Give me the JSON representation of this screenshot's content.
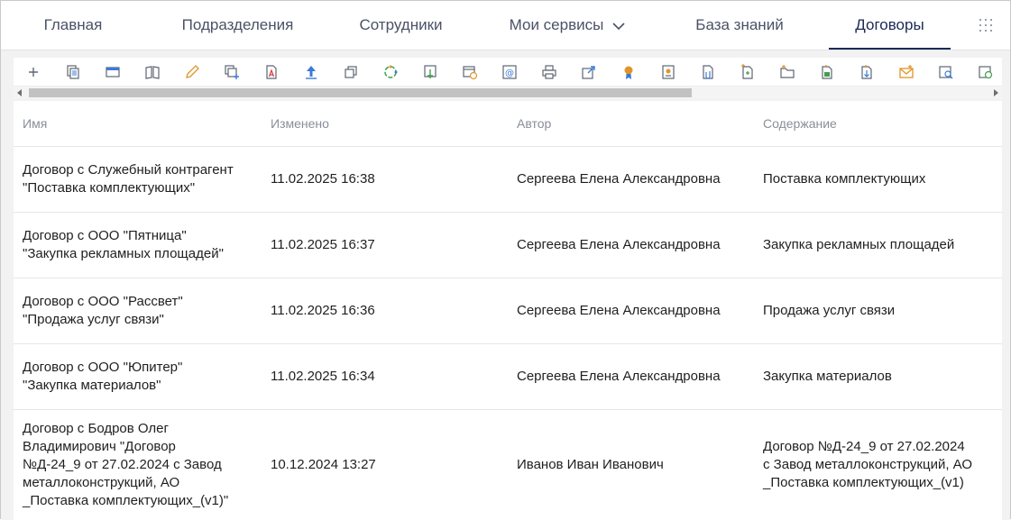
{
  "nav": {
    "items": [
      {
        "label": "Главная"
      },
      {
        "label": "Подразделения"
      },
      {
        "label": "Сотрудники"
      },
      {
        "label": "Мои сервисы"
      },
      {
        "label": "База знаний"
      },
      {
        "label": "Договоры"
      }
    ],
    "active": "Договоры"
  },
  "toolbar": {
    "icons": [
      "plus-icon",
      "copy-document-icon",
      "card-icon",
      "open-book-icon",
      "pencil-icon",
      "copy-add-icon",
      "document-letter-a-icon",
      "upload-arrow-icon",
      "duplicate-icon",
      "refresh-cycle-icon",
      "workflow-icon",
      "calendar-clock-icon",
      "email-document-icon",
      "printer-icon",
      "export-icon",
      "award-ribbon-icon",
      "document-stamp-icon",
      "attach-document-icon",
      "new-document-icon",
      "new-folder-icon",
      "archive-icon",
      "sort-tree-icon",
      "envelope-icon",
      "search-document-icon",
      "history-document-icon"
    ]
  },
  "table": {
    "columns": [
      "Имя",
      "Изменено",
      "Автор",
      "Содержание"
    ],
    "rows": [
      {
        "name": "Договор с Служебный контрагент\n\"Поставка комплектующих\"",
        "changed": "11.02.2025 16:38",
        "author": "Сергеева Елена Александровна",
        "content": "Поставка комплектующих"
      },
      {
        "name": "Договор с ООО \"Пятница\"\n\"Закупка рекламных площадей\"",
        "changed": "11.02.2025 16:37",
        "author": "Сергеева Елена Александровна",
        "content": "Закупка рекламных площадей"
      },
      {
        "name": "Договор с ООО \"Рассвет\"\n\"Продажа услуг связи\"",
        "changed": "11.02.2025 16:36",
        "author": "Сергеева Елена Александровна",
        "content": "Продажа услуг связи"
      },
      {
        "name": "Договор с ООО \"Юпитер\"\n\"Закупка материалов\"",
        "changed": "11.02.2025 16:34",
        "author": "Сергеева Елена Александровна",
        "content": "Закупка материалов"
      },
      {
        "name": "Договор с Бодров Олег\nВладимирович \"Договор\n№Д-24_9 от 27.02.2024 с Завод\nметаллоконструкций, АО\n_Поставка комплектующих_(v1)\"",
        "changed": "10.12.2024 13:27",
        "author": "Иванов Иван Иванович",
        "content": "Договор №Д-24_9 от 27.02.2024\nс Завод металлоконструкций, АО\n_Поставка комплектующих_(v1)"
      }
    ]
  },
  "colors": {
    "nav_active": "#1a2a55",
    "icon_blue": "#3a7bd5",
    "icon_orange": "#e0952a",
    "icon_green": "#3ea14a",
    "icon_gray": "#5f6673"
  }
}
